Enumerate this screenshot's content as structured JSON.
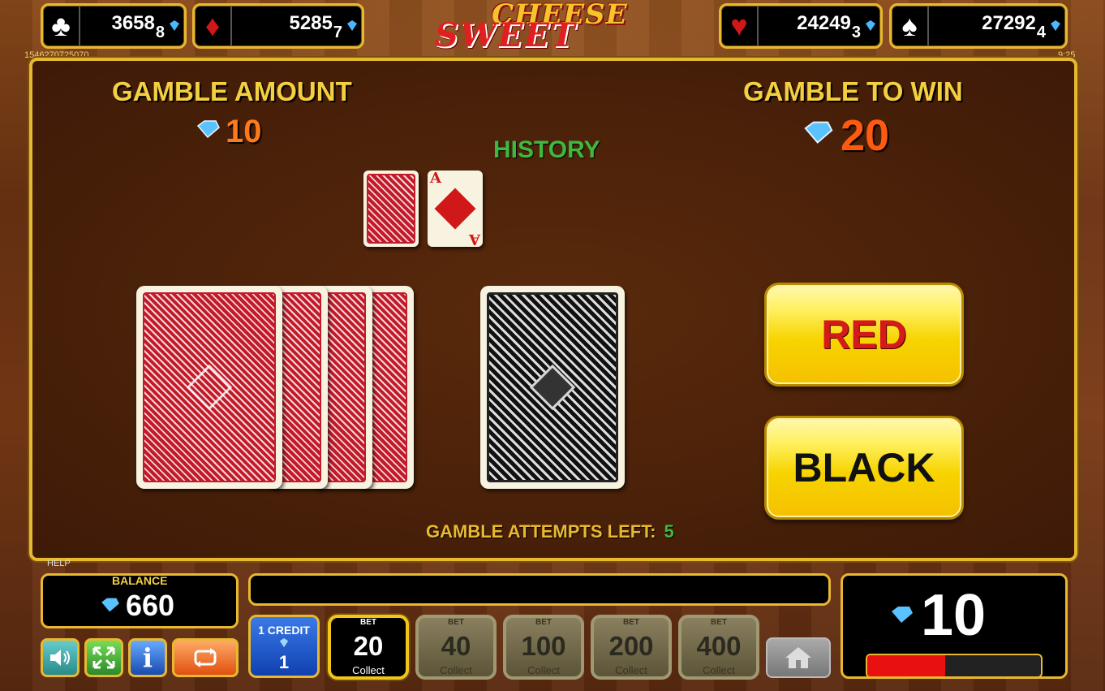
{
  "jackpots": [
    {
      "suit": "club",
      "value": "3658",
      "sub": "8"
    },
    {
      "suit": "diamond",
      "value": "5285",
      "sub": "7"
    },
    {
      "suit": "heart",
      "value": "24249",
      "sub": "3"
    },
    {
      "suit": "spade",
      "value": "27292",
      "sub": "4"
    }
  ],
  "logo": {
    "line1": "CHEESE",
    "line2": "SWEET"
  },
  "corner": {
    "left_id": "1546270725070",
    "right_time": "9:25"
  },
  "gamble": {
    "amount_label": "GAMBLE AMOUNT",
    "amount_value": "10",
    "to_win_label": "GAMBLE TO WIN",
    "to_win_value": "20",
    "history_label": "HISTORY",
    "history_card_rank": "A",
    "red_label": "RED",
    "black_label": "BLACK",
    "attempts_label": "GAMBLE ATTEMPTS LEFT:",
    "attempts_value": "5"
  },
  "bottom": {
    "help_label": "HELP",
    "balance_label": "BALANCE",
    "balance_value": "660",
    "credit_label": "1 CREDIT",
    "credit_value": "1",
    "win_value": "10",
    "win_progress": 0.45,
    "bets": [
      {
        "top": "BET",
        "value": "20",
        "sub": "Collect",
        "active": true
      },
      {
        "top": "BET",
        "value": "40",
        "sub": "Collect",
        "active": false
      },
      {
        "top": "BET",
        "value": "100",
        "sub": "Collect",
        "active": false
      },
      {
        "top": "BET",
        "value": "200",
        "sub": "Collect",
        "active": false
      },
      {
        "top": "BET",
        "value": "400",
        "sub": "Collect",
        "active": false
      }
    ]
  },
  "colors": {
    "gold": "#e8b830",
    "orange": "#ff7a1a",
    "green": "#3fb83f",
    "red_text": "#d41a1a"
  }
}
